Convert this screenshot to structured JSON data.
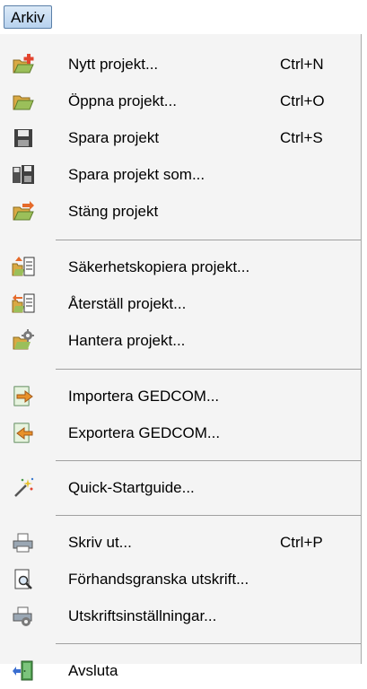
{
  "menubar": {
    "title": "Arkiv"
  },
  "menu": {
    "items": [
      {
        "label": "Nytt projekt...",
        "shortcut": "Ctrl+N",
        "icon": "new-project-icon"
      },
      {
        "label": "Öppna projekt...",
        "shortcut": "Ctrl+O",
        "icon": "open-project-icon"
      },
      {
        "label": "Spara projekt",
        "shortcut": "Ctrl+S",
        "icon": "save-icon"
      },
      {
        "label": "Spara projekt som...",
        "shortcut": "",
        "icon": "save-as-icon"
      },
      {
        "label": "Stäng projekt",
        "shortcut": "",
        "icon": "close-project-icon"
      },
      {
        "label": "Säkerhetskopiera projekt...",
        "shortcut": "",
        "icon": "backup-icon"
      },
      {
        "label": "Återställ projekt...",
        "shortcut": "",
        "icon": "restore-icon"
      },
      {
        "label": "Hantera projekt...",
        "shortcut": "",
        "icon": "manage-projects-icon"
      },
      {
        "label": "Importera GEDCOM...",
        "shortcut": "",
        "icon": "import-icon"
      },
      {
        "label": "Exportera GEDCOM...",
        "shortcut": "",
        "icon": "export-icon"
      },
      {
        "label": "Quick-Startguide...",
        "shortcut": "",
        "icon": "wizard-icon"
      },
      {
        "label": "Skriv ut...",
        "shortcut": "Ctrl+P",
        "icon": "print-icon"
      },
      {
        "label": "Förhandsgranska utskrift...",
        "shortcut": "",
        "icon": "print-preview-icon"
      },
      {
        "label": "Utskriftsinställningar...",
        "shortcut": "",
        "icon": "print-settings-icon"
      },
      {
        "label": "Avsluta",
        "shortcut": "",
        "icon": "exit-icon"
      }
    ]
  }
}
